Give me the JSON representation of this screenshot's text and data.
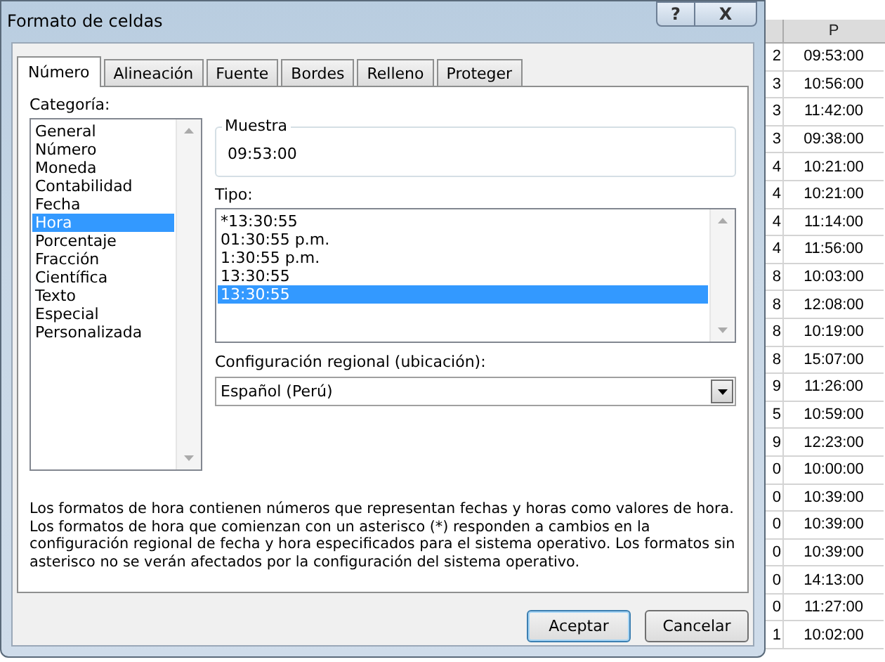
{
  "sheet": {
    "column_header": "P",
    "left_column": [
      "2",
      "3",
      "3",
      "3",
      "4",
      "4",
      "4",
      "4",
      "8",
      "8",
      "8",
      "8",
      "9",
      "5",
      "9",
      "0",
      "0",
      "0",
      "0",
      "0",
      "0",
      "1"
    ],
    "cells": [
      "09:53:00",
      "10:56:00",
      "11:42:00",
      "09:38:00",
      "10:21:00",
      "10:21:00",
      "11:14:00",
      "11:56:00",
      "10:03:00",
      "12:08:00",
      "10:19:00",
      "15:07:00",
      "11:26:00",
      "10:59:00",
      "12:23:00",
      "10:00:00",
      "10:39:00",
      "10:39:00",
      "10:39:00",
      "14:13:00",
      "11:27:00",
      "10:02:00"
    ]
  },
  "window": {
    "title": "Formato de celdas",
    "help_button": "?",
    "close_button": "X"
  },
  "tabs": [
    {
      "label": "Número",
      "selected": true
    },
    {
      "label": "Alineación",
      "selected": false
    },
    {
      "label": "Fuente",
      "selected": false
    },
    {
      "label": "Bordes",
      "selected": false
    },
    {
      "label": "Relleno",
      "selected": false
    },
    {
      "label": "Proteger",
      "selected": false
    }
  ],
  "category": {
    "label": "Categoría:",
    "items": [
      {
        "label": "General",
        "selected": false
      },
      {
        "label": "Número",
        "selected": false
      },
      {
        "label": "Moneda",
        "selected": false
      },
      {
        "label": "Contabilidad",
        "selected": false
      },
      {
        "label": "Fecha",
        "selected": false
      },
      {
        "label": "Hora",
        "selected": true
      },
      {
        "label": "Porcentaje",
        "selected": false
      },
      {
        "label": "Fracción",
        "selected": false
      },
      {
        "label": "Científica",
        "selected": false
      },
      {
        "label": "Texto",
        "selected": false
      },
      {
        "label": "Especial",
        "selected": false
      },
      {
        "label": "Personalizada",
        "selected": false
      }
    ]
  },
  "sample": {
    "label": "Muestra",
    "value": "09:53:00"
  },
  "type": {
    "label": "Tipo:",
    "items": [
      {
        "label": "*13:30:55",
        "selected": false
      },
      {
        "label": "01:30:55 p.m.",
        "selected": false
      },
      {
        "label": "1:30:55 p.m.",
        "selected": false
      },
      {
        "label": "13:30:55",
        "selected": false
      },
      {
        "label": "13:30:55",
        "selected": true
      }
    ]
  },
  "locale": {
    "label": "Configuración regional (ubicación):",
    "value": "Español (Perú)"
  },
  "description": "Los formatos de hora contienen números que representan fechas y horas como valores de hora. Los formatos de hora que comienzan con un asterisco (*) responden a cambios en la configuración regional de fecha y hora especificados para el sistema operativo. Los formatos sin asterisco no se verán afectados por la configuración del sistema operativo.",
  "buttons": [
    "Aceptar",
    "Cancelar"
  ]
}
